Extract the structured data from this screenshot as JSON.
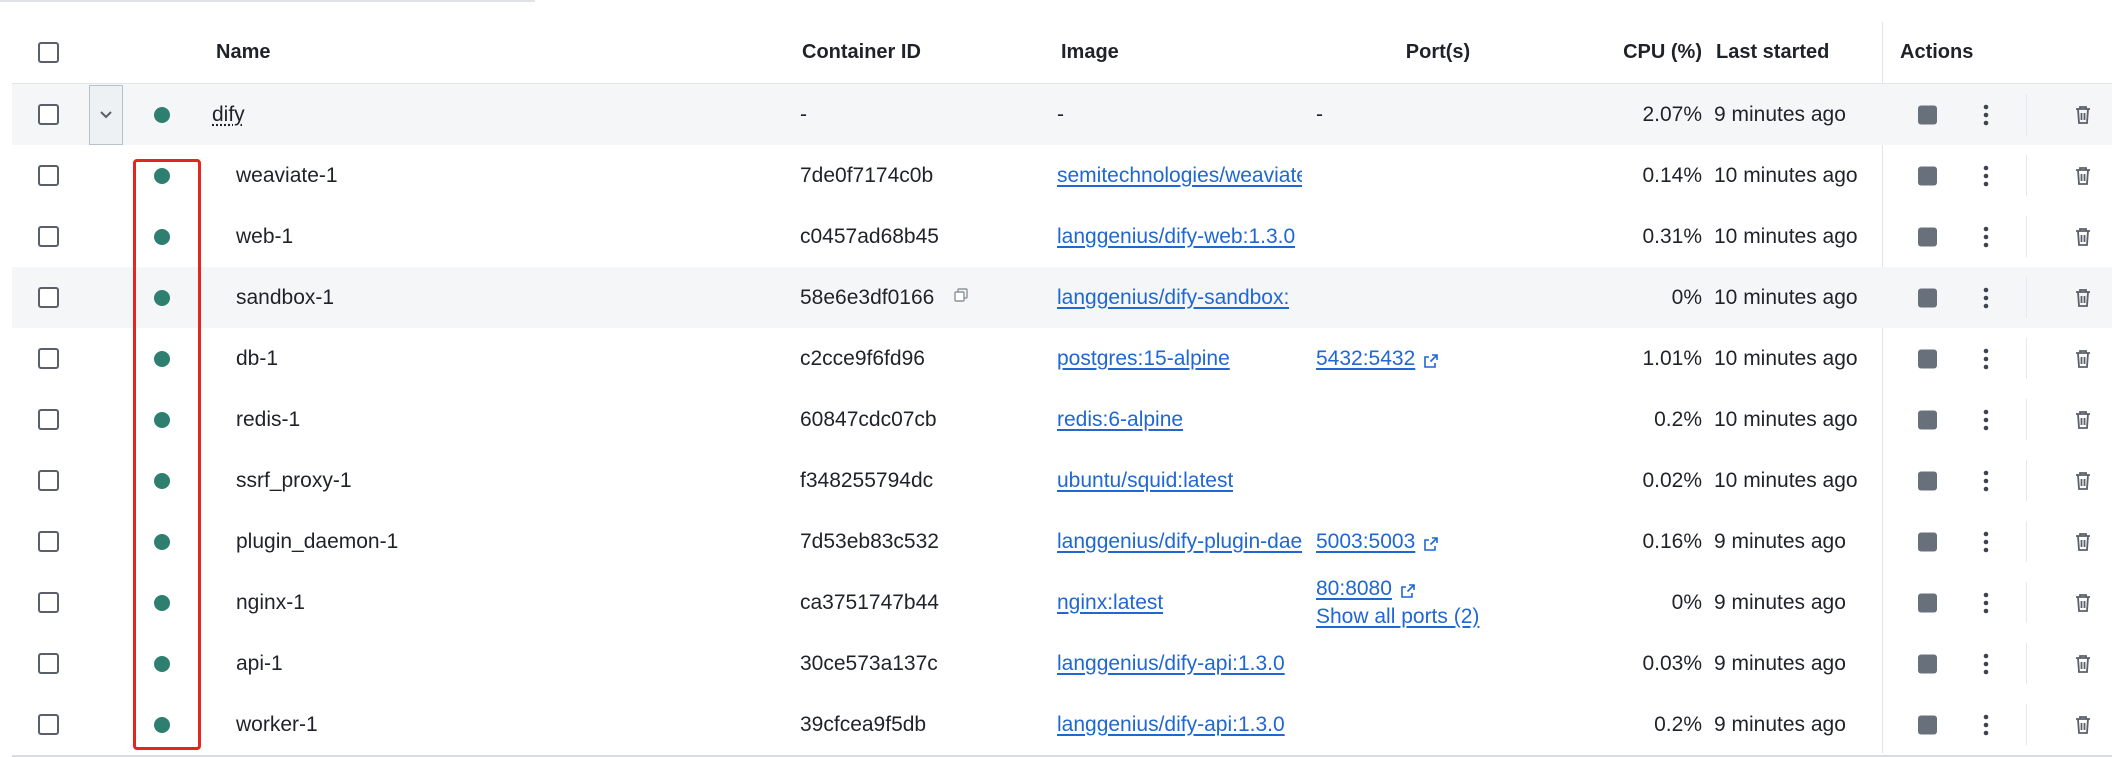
{
  "header": {
    "name": "Name",
    "container_id": "Container ID",
    "image": "Image",
    "ports": "Port(s)",
    "cpu": "CPU (%)",
    "last_started": "Last started",
    "actions": "Actions"
  },
  "group": {
    "name": "dify",
    "container_id": "-",
    "image": "-",
    "ports": "-",
    "cpu": "2.07%",
    "last_started": "9 minutes ago"
  },
  "rows": [
    {
      "name": "weaviate-1",
      "container_id": "7de0f7174c0b",
      "image": "semitechnologies/weaviate",
      "ports": "",
      "more_ports": "",
      "cpu": "0.14%",
      "last_started": "10 minutes ago"
    },
    {
      "name": "web-1",
      "container_id": "c0457ad68b45",
      "image": "langgenius/dify-web:1.3.0",
      "ports": "",
      "more_ports": "",
      "cpu": "0.31%",
      "last_started": "10 minutes ago"
    },
    {
      "name": "sandbox-1",
      "container_id": "58e6e3df0166",
      "image": "langgenius/dify-sandbox:",
      "ports": "",
      "more_ports": "",
      "cpu": "0%",
      "last_started": "10 minutes ago"
    },
    {
      "name": "db-1",
      "container_id": "c2cce9f6fd96",
      "image": "postgres:15-alpine",
      "ports": "5432:5432",
      "more_ports": "",
      "cpu": "1.01%",
      "last_started": "10 minutes ago"
    },
    {
      "name": "redis-1",
      "container_id": "60847cdc07cb",
      "image": "redis:6-alpine",
      "ports": "",
      "more_ports": "",
      "cpu": "0.2%",
      "last_started": "10 minutes ago"
    },
    {
      "name": "ssrf_proxy-1",
      "container_id": "f348255794dc",
      "image": "ubuntu/squid:latest",
      "ports": "",
      "more_ports": "",
      "cpu": "0.02%",
      "last_started": "10 minutes ago"
    },
    {
      "name": "plugin_daemon-1",
      "container_id": "7d53eb83c532",
      "image": "langgenius/dify-plugin-daemon",
      "ports": "5003:5003",
      "more_ports": "",
      "cpu": "0.16%",
      "last_started": "9 minutes ago"
    },
    {
      "name": "nginx-1",
      "container_id": "ca3751747b44",
      "image": "nginx:latest",
      "ports": "80:8080",
      "more_ports": "Show all ports (2)",
      "cpu": "0%",
      "last_started": "9 minutes ago"
    },
    {
      "name": "api-1",
      "container_id": "30ce573a137c",
      "image": "langgenius/dify-api:1.3.0",
      "ports": "",
      "more_ports": "",
      "cpu": "0.03%",
      "last_started": "9 minutes ago"
    },
    {
      "name": "worker-1",
      "container_id": "39cfcea9f5db",
      "image": "langgenius/dify-api:1.3.0",
      "ports": "",
      "more_ports": "",
      "cpu": "0.2%",
      "last_started": "9 minutes ago"
    }
  ],
  "colors": {
    "status_running": "#2f7f70",
    "link": "#1f67d2",
    "highlight_box": "#e3261f"
  },
  "icons": {
    "expand": "chevron-down-icon",
    "copy": "copy-icon",
    "external": "external-link-icon",
    "stop": "stop-icon",
    "more": "more-vertical-icon",
    "delete": "trash-icon"
  }
}
